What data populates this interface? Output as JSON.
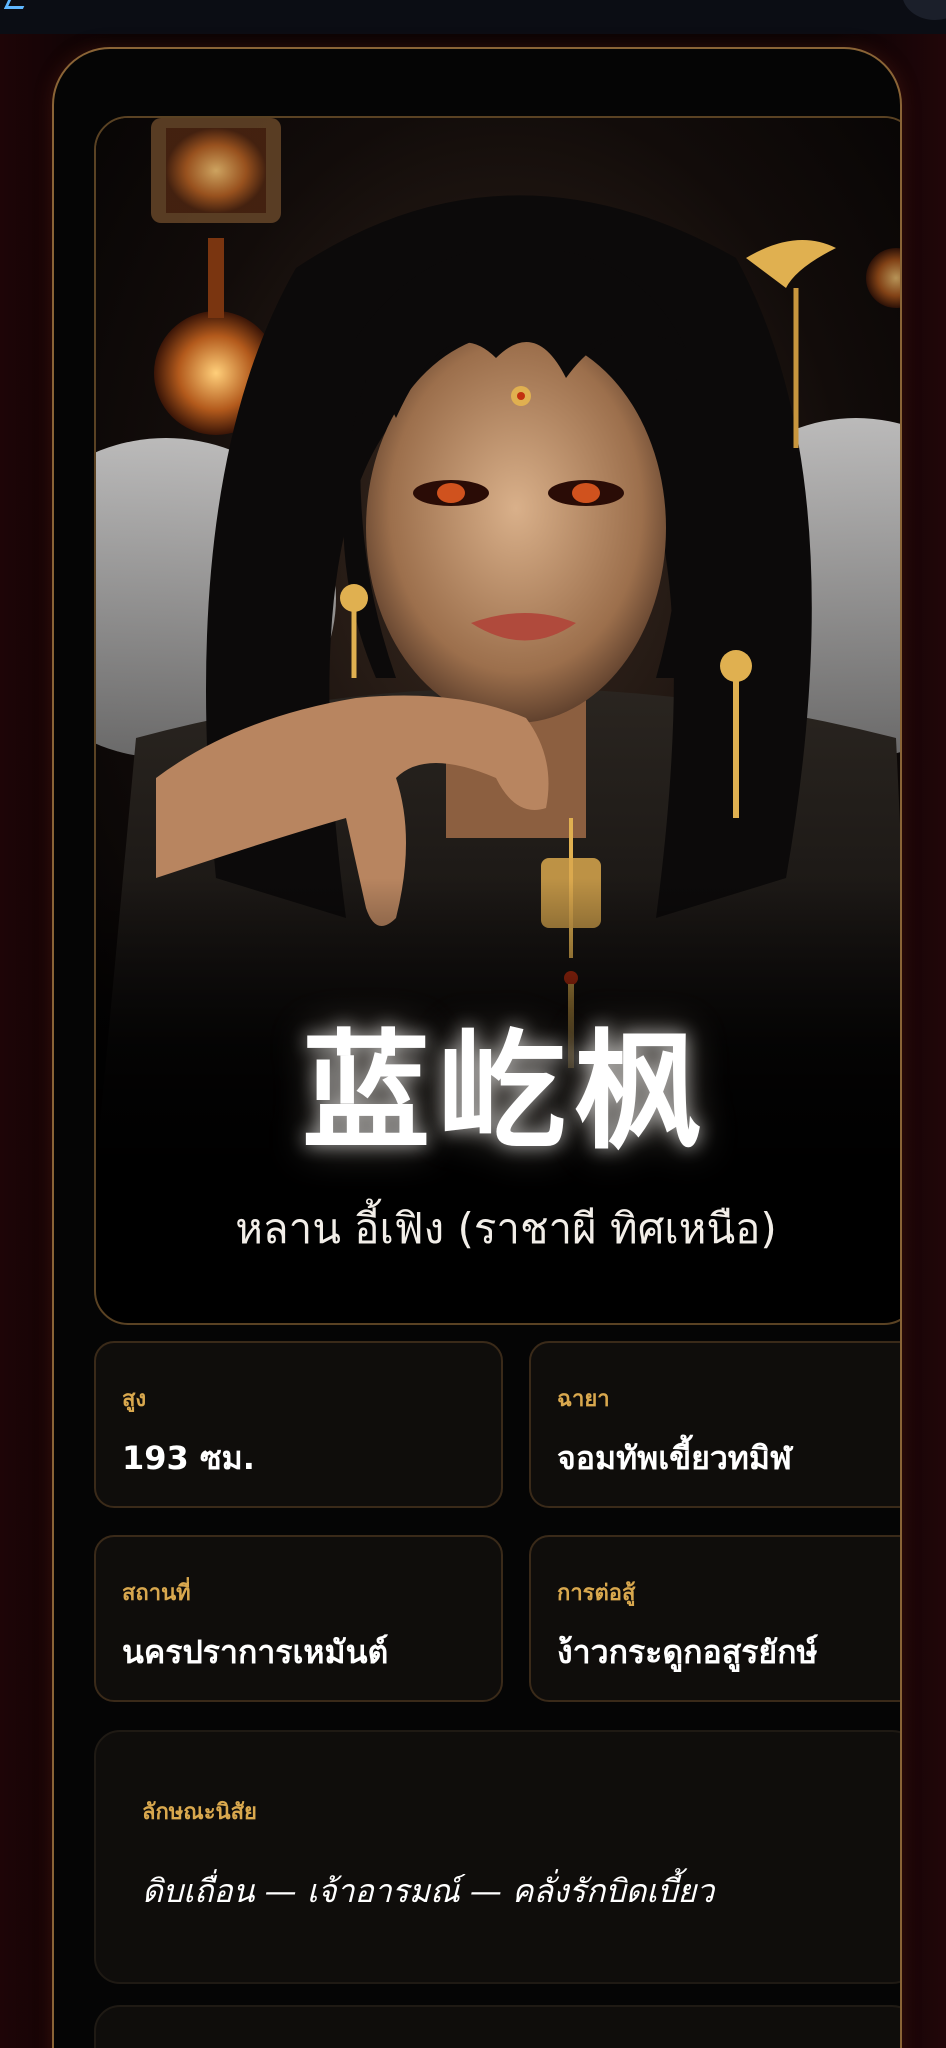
{
  "profile": {
    "hanzi_name": "蓝屹枫",
    "thai_name": "หลาน อี้เฟิง (ราชาผี ทิศเหนือ)"
  },
  "stats": [
    {
      "label": "สูง",
      "value": "193 ซม."
    },
    {
      "label": "ฉายา",
      "value": "จอมทัพเขี้ยวทมิฬ"
    },
    {
      "label": "สถานที่",
      "value": "นครปราการเหมันต์"
    },
    {
      "label": "การต่อสู้",
      "value": "ง้าวกระดูกอสูรยักษ์"
    }
  ],
  "traits": {
    "label": "ลักษณะนิสัย",
    "value": "ดิบเถื่อน — เจ้าอารมณ์ — คลั่งรักบิดเบี้ยว"
  },
  "colors": {
    "accent_gold": "#d9a84e",
    "card_border": "#8a6436",
    "card_background": "#050505"
  }
}
